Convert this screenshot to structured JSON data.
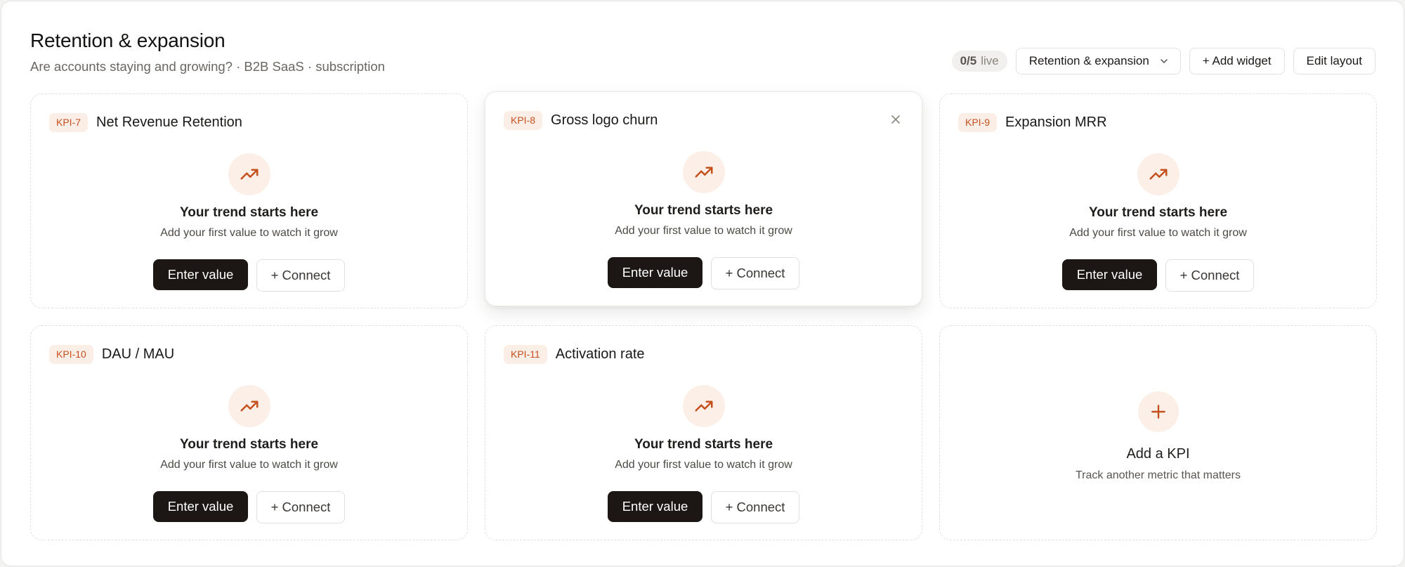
{
  "header": {
    "title": "Retention & expansion",
    "subtitle": "Are accounts staying and growing? · B2B SaaS · subscription"
  },
  "toolbar": {
    "live_count": "0/5",
    "live_label": "live",
    "view_select": "Retention & expansion",
    "add_widget": "+ Add widget",
    "edit_layout": "Edit layout"
  },
  "empty_state": {
    "title": "Your trend starts here",
    "subtitle": "Add your first value to watch it grow",
    "primary": "Enter value",
    "secondary": "+ Connect"
  },
  "kpis": [
    {
      "id": "KPI-7",
      "name": "Net Revenue Retention"
    },
    {
      "id": "KPI-8",
      "name": "Gross logo churn"
    },
    {
      "id": "KPI-9",
      "name": "Expansion MRR"
    },
    {
      "id": "KPI-10",
      "name": "DAU / MAU"
    },
    {
      "id": "KPI-11",
      "name": "Activation rate"
    }
  ],
  "add_kpi": {
    "title": "Add a KPI",
    "subtitle": "Track another metric that matters"
  },
  "icons": {
    "trend": "trending-up-icon",
    "plus": "plus-icon",
    "close": "close-icon",
    "chevron": "chevron-down-icon"
  },
  "colors": {
    "accent": "#c4501e",
    "accent_soft": "#fbefe7",
    "primary_button": "#1c1714"
  }
}
